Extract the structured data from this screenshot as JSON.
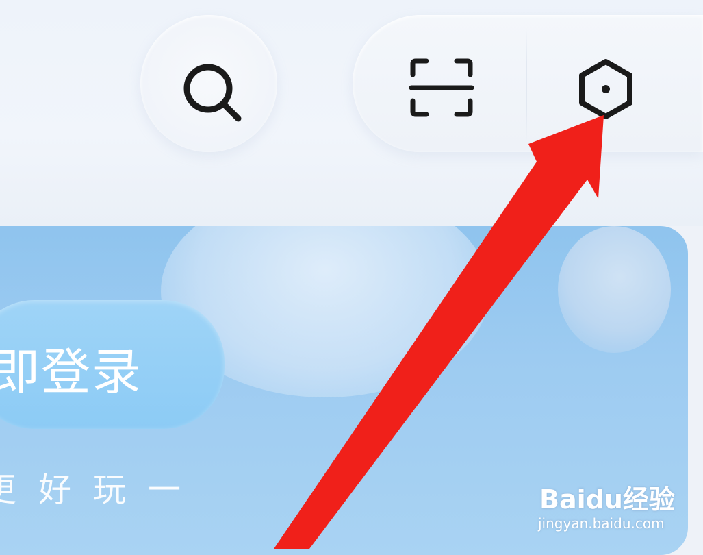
{
  "header": {
    "search_icon": "search-icon",
    "scan_icon": "scan-icon",
    "settings_icon": "settings-hexagon-icon"
  },
  "banner": {
    "login_label": "即登录",
    "slogan": "更好玩一"
  },
  "annotation": {
    "arrow_color": "#f0201a"
  },
  "watermark": {
    "logo_text": "Baidu经验",
    "url": "jingyan.baidu.com"
  },
  "colors": {
    "banner_blue": "#9dcbf1",
    "icon_stroke": "#1a1a1a"
  }
}
